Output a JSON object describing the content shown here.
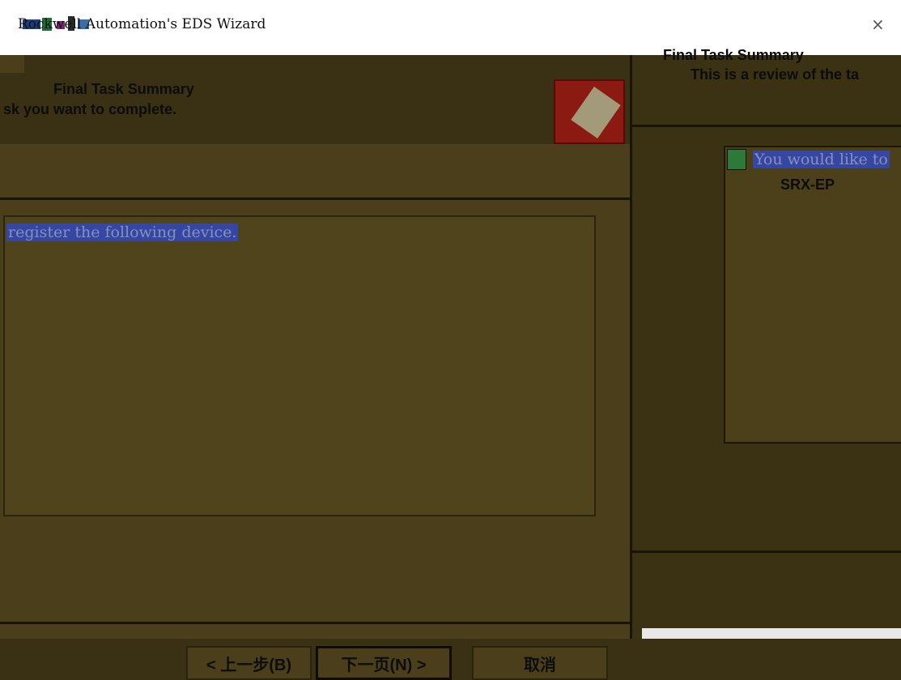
{
  "window": {
    "title": "Rockwell Automation's EDS Wizard",
    "close_glyph": "×"
  },
  "wizard": {
    "header_title": "Final Task Summary",
    "header_subtitle": "sk you want to complete.",
    "summary_text": "register the following device.",
    "buttons": {
      "back": "< 上一步(B)",
      "next": "下一页(N) >",
      "cancel": "取消"
    }
  },
  "right_panel": {
    "title": "Final Task Summary",
    "subtitle": "This is a review of the ta",
    "highlight": "You would like to",
    "device": "SRX-EP"
  },
  "colors": {
    "background": "#3a3014",
    "highlight": "#3546a3",
    "logo": "#8b1a12"
  }
}
